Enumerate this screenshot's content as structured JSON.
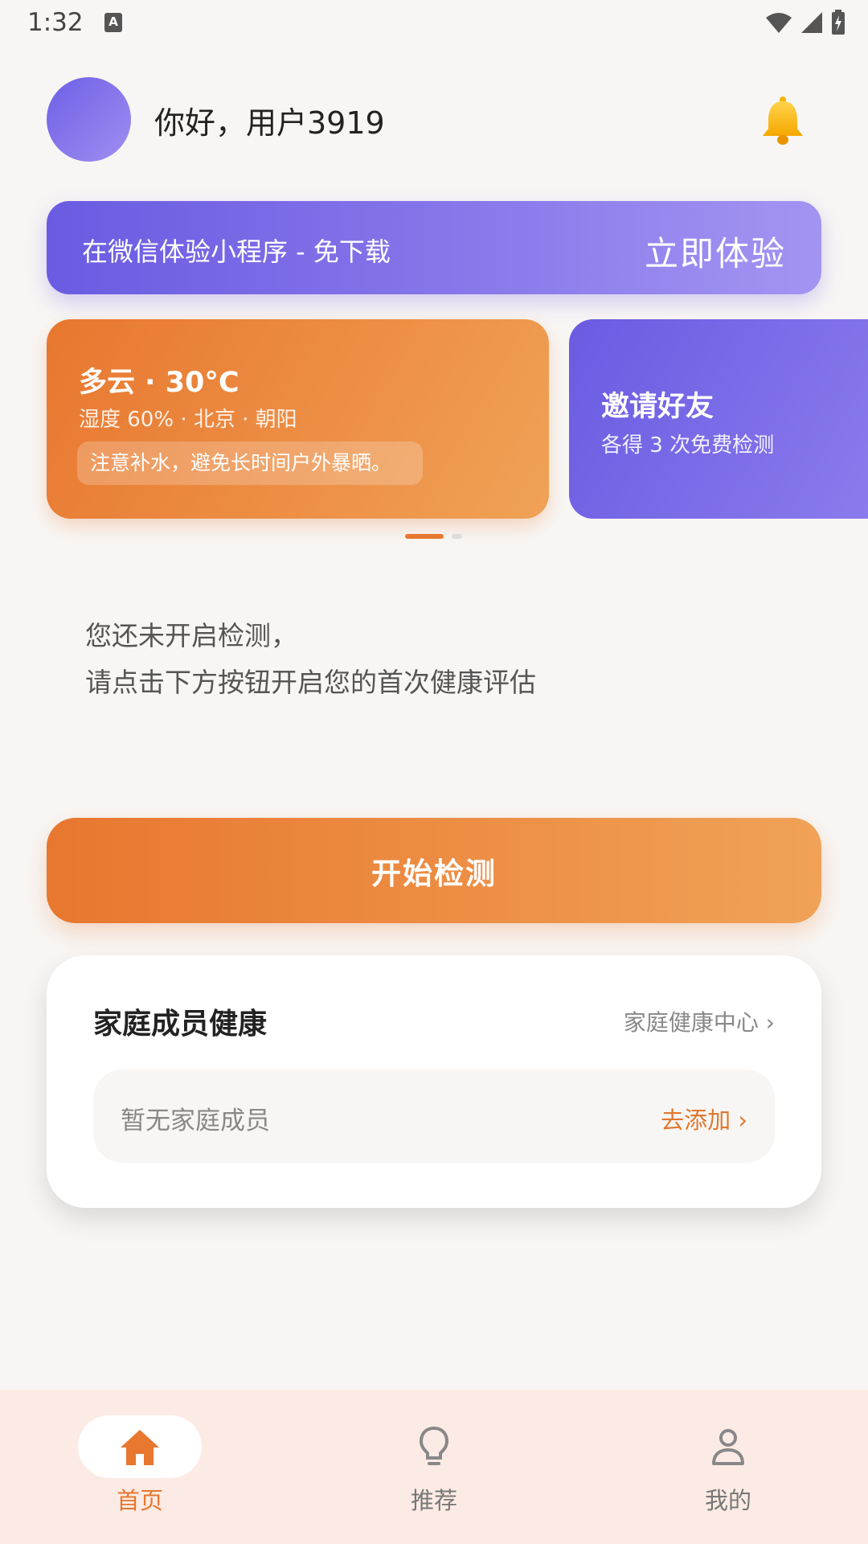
{
  "status_bar": {
    "time": "1:32",
    "badge": "A"
  },
  "header": {
    "greeting": "你好，用户3919"
  },
  "mini_banner": {
    "text": "在微信体验小程序 - 免下载",
    "cta": "立即体验"
  },
  "carousel": {
    "weather": {
      "title": "多云 · 30°C",
      "subtitle": "湿度 60% · 北京 · 朝阳",
      "tip": "注意补水，避免长时间户外暴晒。"
    },
    "invite": {
      "title": "邀请好友",
      "subtitle": "各得 3 次免费检测"
    }
  },
  "empty_state": {
    "line1": "您还未开启检测，",
    "line2": "请点击下方按钮开启您的首次健康评估"
  },
  "start_button": {
    "label": "开始检测"
  },
  "family": {
    "title": "家庭成员健康",
    "link": "家庭健康中心 ›",
    "empty": "暂无家庭成员",
    "add": "去添加 ›"
  },
  "bottom_nav": {
    "items": [
      {
        "label": "首页",
        "icon": "home-icon",
        "active": true
      },
      {
        "label": "推荐",
        "icon": "lightbulb-icon",
        "active": false
      },
      {
        "label": "我的",
        "icon": "person-icon",
        "active": false
      }
    ]
  },
  "colors": {
    "accent": "#e8772f",
    "purple": "#6a5be2",
    "background": "#f8f6f4",
    "nav_bg": "#fcebe4"
  }
}
